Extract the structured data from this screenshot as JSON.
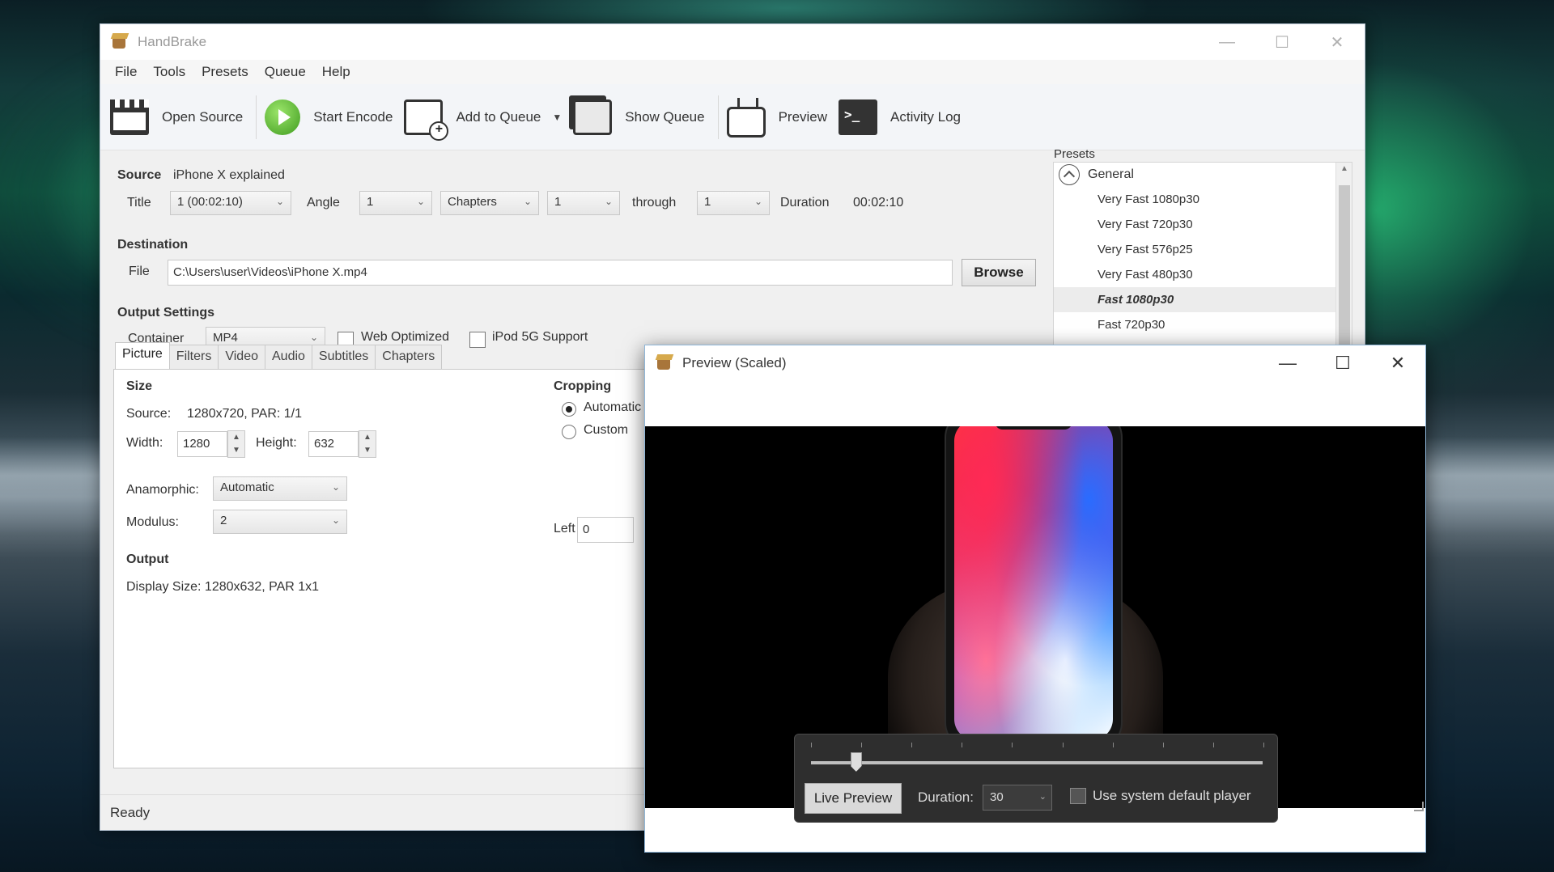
{
  "main_window": {
    "title": "HandBrake",
    "controls": {
      "minimize": "—",
      "maximize": "☐",
      "close": "✕"
    }
  },
  "menu": [
    "File",
    "Tools",
    "Presets",
    "Queue",
    "Help"
  ],
  "toolbar": {
    "open_source": "Open Source",
    "start_encode": "Start Encode",
    "add_to_queue": "Add to Queue",
    "show_queue": "Show Queue",
    "preview": "Preview",
    "activity_log": "Activity Log"
  },
  "source": {
    "label": "Source",
    "name": "iPhone X explained",
    "title_label": "Title",
    "title_value": "1 (00:02:10)",
    "angle_label": "Angle",
    "angle_value": "1",
    "range_mode": "Chapters",
    "range_start": "1",
    "through_label": "through",
    "range_end": "1",
    "duration_label": "Duration",
    "duration_value": "00:02:10"
  },
  "destination": {
    "label": "Destination",
    "file_label": "File",
    "file_path": "C:\\Users\\user\\Videos\\iPhone X.mp4",
    "browse": "Browse"
  },
  "output_settings": {
    "label": "Output Settings",
    "container_label": "Container",
    "container_value": "MP4",
    "web_optimized": "Web Optimized",
    "ipod_support": "iPod 5G Support"
  },
  "tabs": [
    "Picture",
    "Filters",
    "Video",
    "Audio",
    "Subtitles",
    "Chapters"
  ],
  "picture": {
    "size_label": "Size",
    "source_label": "Source:",
    "source_value": "1280x720, PAR: 1/1",
    "width_label": "Width:",
    "width_value": "1280",
    "height_label": "Height:",
    "height_value": "632",
    "anamorphic_label": "Anamorphic:",
    "anamorphic_value": "Automatic",
    "modulus_label": "Modulus:",
    "modulus_value": "2",
    "output_label": "Output",
    "display_size": "Display Size: 1280x632,  PAR 1x1",
    "cropping_label": "Cropping",
    "crop_auto": "Automatic",
    "crop_custom": "Custom",
    "left_label": "Left",
    "left_value": "0"
  },
  "presets": {
    "label": "Presets",
    "group": "General",
    "items": [
      "Very Fast 1080p30",
      "Very Fast 720p30",
      "Very Fast 576p25",
      "Very Fast 480p30",
      "Fast 1080p30",
      "Fast 720p30"
    ],
    "selected_index": 4
  },
  "status": "Ready",
  "preview_window": {
    "title": "Preview (Scaled)",
    "controls": {
      "minimize": "—",
      "maximize": "☐",
      "close": "✕"
    },
    "live_preview": "Live Preview",
    "duration_label": "Duration:",
    "duration_value": "30",
    "use_default_player": "Use system default player",
    "slider_position": 0.1
  }
}
